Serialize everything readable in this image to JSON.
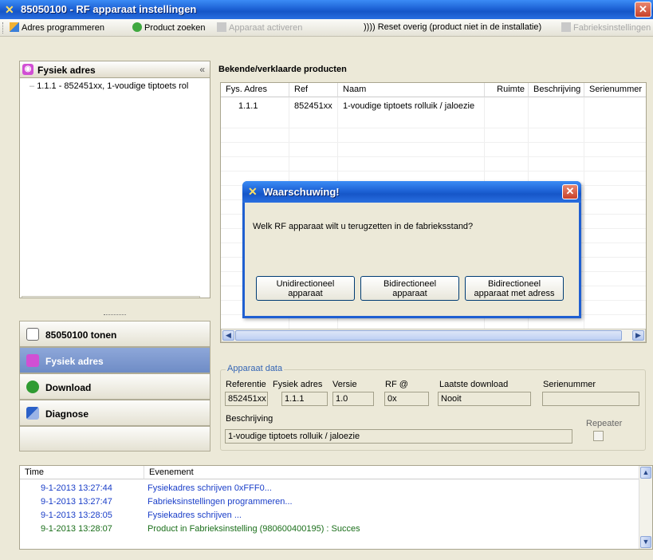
{
  "window": {
    "title": "85050100 - RF apparaat instellingen"
  },
  "toolbar": {
    "adres_programmeren": "Adres programmeren",
    "product_zoeken": "Product zoeken",
    "apparaat_activeren": "Apparaat activeren",
    "reset_overig": ")))) Reset overig (product niet in de installatie)",
    "fabrieksinstellingen": "Fabrieksinstellingen"
  },
  "left_panel": {
    "header": "Fysiek adres",
    "collapse": "«",
    "tree_items": [
      "1.1.1 - 852451xx, 1-voudige tiptoets rol"
    ],
    "nav": [
      {
        "label": "85050100 tonen"
      },
      {
        "label": "Fysiek adres"
      },
      {
        "label": "Download"
      },
      {
        "label": "Diagnose"
      }
    ]
  },
  "products": {
    "title": "Bekende/verklaarde producten",
    "columns": [
      "Fys. Adres",
      "Ref",
      "Naam",
      "Ruimte",
      "Beschrijving",
      "Serienummer"
    ],
    "rows": [
      [
        "1.1.1",
        "852451xx",
        "1-voudige tiptoets rolluik / jaloezie",
        "",
        "",
        ""
      ]
    ]
  },
  "apparaat_data": {
    "title": "Apparaat data",
    "referentie_label": "Referentie",
    "referentie": "852451xx",
    "fysiek_label": "Fysiek adres",
    "fysiek": "1.1.1",
    "versie_label": "Versie",
    "versie": "1.0",
    "rf_label": "RF @",
    "rf": "0x",
    "download_label": "Laatste download",
    "download": "Nooit",
    "serienummer_label": "Serienummer",
    "serienummer": "",
    "beschrijving_label": "Beschrijving",
    "beschrijving": "1-voudige tiptoets rolluik / jaloezie",
    "repeater_label": "Repeater"
  },
  "log": {
    "columns": [
      "Time",
      "Evenement"
    ],
    "rows": [
      {
        "time": "9-1-2013 13:27:44",
        "event": "Fysiekadres schrijven 0xFFF0..."
      },
      {
        "time": "9-1-2013 13:27:47",
        "event": "Fabrieksinstellingen programmeren..."
      },
      {
        "time": "9-1-2013 13:28:05",
        "event": "Fysiekadres schrijven ..."
      },
      {
        "time": "9-1-2013 13:28:07",
        "event": "Product in Fabrieksinstelling (980600400195) : Succes"
      }
    ]
  },
  "dialog": {
    "title": "Waarschuwing!",
    "message": "Welk RF apparaat wilt u terugzetten in de fabrieksstand?",
    "btn1_line1": "Unidirectioneel",
    "btn1_line2": "apparaat",
    "btn2_line1": "Bidirectioneel",
    "btn2_line2": "apparaat",
    "btn3_line1": "Bidirectioneel",
    "btn3_line2": "apparaat  met adress"
  },
  "colors": {
    "titlebar": "#1e63d6",
    "log_text": "#1a3ec8",
    "group_title": "#3465b5",
    "nav_active": "#7b96cf"
  }
}
